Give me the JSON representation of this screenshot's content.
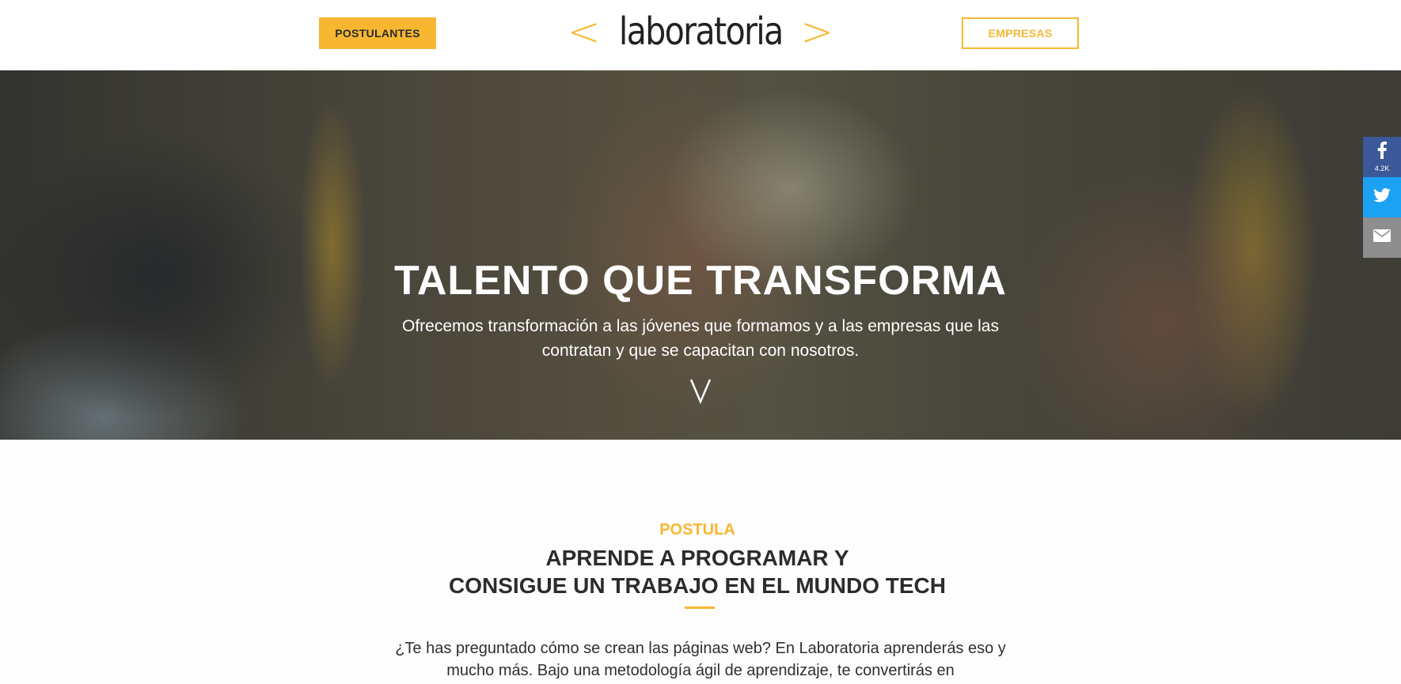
{
  "header": {
    "postulantes_label": "POSTULANTES",
    "empresas_label": "EMPRESAS",
    "logo": {
      "left_bracket": "<",
      "wordmark": "laboratoria",
      "right_bracket": ">"
    }
  },
  "hero": {
    "title": "TALENTO QUE TRANSFORMA",
    "subtitle": "Ofrecemos transformación a las jóvenes que formamos y a las empresas que las contratan y que se capacitan con nosotros.",
    "scroll_icon": "chevron-down-icon"
  },
  "share": {
    "facebook": {
      "icon": "facebook-icon",
      "count": "4.2K"
    },
    "twitter": {
      "icon": "twitter-icon"
    },
    "email": {
      "icon": "mail-icon"
    }
  },
  "postula": {
    "eyebrow": "POSTULA",
    "title_line1": "APRENDE A PROGRAMAR Y",
    "title_line2": "CONSIGUE UN TRABAJO EN EL MUNDO TECH",
    "body": "¿Te has preguntado cómo se crean las páginas web? En Laboratoria aprenderás eso y mucho más. Bajo una metodología ágil de aprendizaje, te convertirás en"
  },
  "colors": {
    "accent": "#f7b731",
    "facebook": "#3b5998",
    "twitter": "#1da1f2",
    "email": "#8e8e8e",
    "text_dark": "#2c2c2c"
  }
}
